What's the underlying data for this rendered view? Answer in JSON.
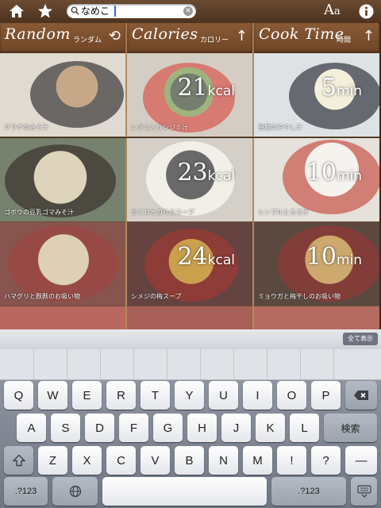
{
  "toolbar": {
    "search_value": "なめこ",
    "font_button_label_big": "A",
    "font_button_label_small": "a",
    "icons": [
      "home-icon",
      "star-icon",
      "search-icon",
      "clear-icon",
      "info-icon"
    ]
  },
  "columns": [
    {
      "title": "Random",
      "subtitle": "ランダム",
      "arrow": "⟲"
    },
    {
      "title": "Calories",
      "subtitle": "カロリー",
      "arrow": "↑"
    },
    {
      "title": "Cook Time",
      "subtitle": "時間",
      "arrow": "↑"
    }
  ],
  "tiles": [
    {
      "caption": "クラゲのみそ汁",
      "value": "",
      "unit": ""
    },
    {
      "caption": "レタス入りシジミ汁",
      "value": "21",
      "unit": "kcal"
    },
    {
      "caption": "豆腐の冷やし汁",
      "value": "5",
      "unit": "min"
    },
    {
      "caption": "ゴボウの豆乳ゴマみそ汁",
      "value": "",
      "unit": ""
    },
    {
      "caption": "ちくわとのりのスープ",
      "value": "23",
      "unit": "kcal"
    },
    {
      "caption": "シンプルとろろ汁",
      "value": "10",
      "unit": "min"
    },
    {
      "caption": "ハマグリと麩麩のお吸い物",
      "value": "",
      "unit": ""
    },
    {
      "caption": "シメジの梅スープ",
      "value": "24",
      "unit": "kcal"
    },
    {
      "caption": "ミョウガと梅干しのお吸い物",
      "value": "10",
      "unit": "min"
    }
  ],
  "keyboard": {
    "show_all": "全て表示",
    "row1": [
      "Q",
      "W",
      "E",
      "R",
      "T",
      "Y",
      "U",
      "I",
      "O",
      "P"
    ],
    "row2": [
      "A",
      "S",
      "D",
      "F",
      "G",
      "H",
      "J",
      "K",
      "L"
    ],
    "row3": [
      "Z",
      "X",
      "C",
      "V",
      "B",
      "N",
      "M",
      "!",
      "?"
    ],
    "search_key": "検索",
    "numbers_key": ".?123",
    "row3_extra": "—"
  },
  "colors": {
    "wood": "#7a4f2e",
    "accent": "#2c6bd8"
  }
}
